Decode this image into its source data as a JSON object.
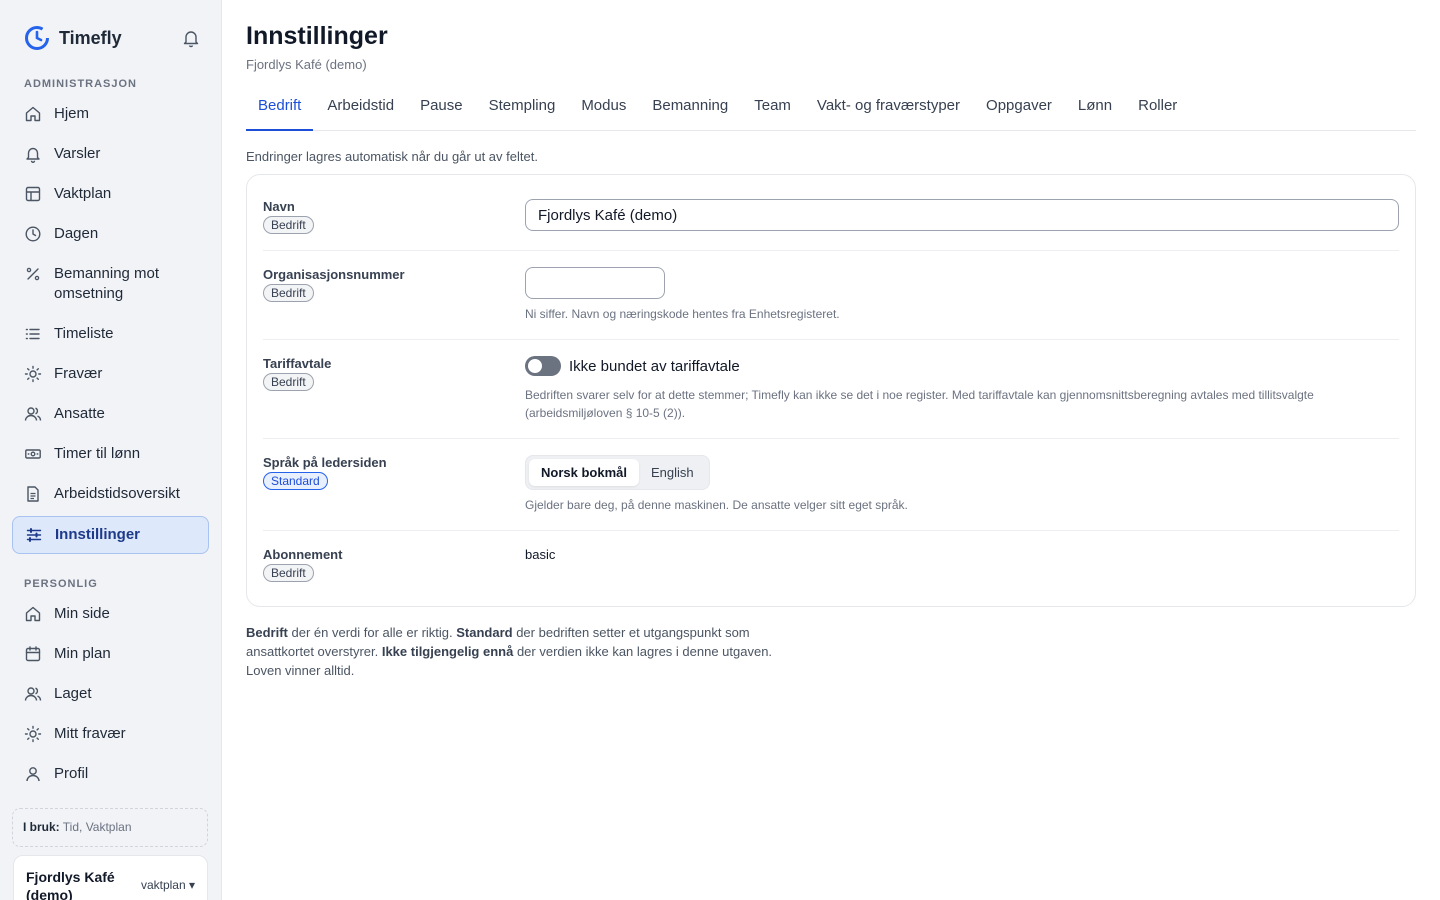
{
  "brand": {
    "name": "Timefly"
  },
  "sidebar": {
    "admin_label": "ADMINISTRASJON",
    "admin_items": [
      {
        "label": "Hjem",
        "icon": "home-icon"
      },
      {
        "label": "Varsler",
        "icon": "bell-icon"
      },
      {
        "label": "Vaktplan",
        "icon": "table-icon"
      },
      {
        "label": "Dagen",
        "icon": "clock-icon"
      },
      {
        "label": "Bemanning mot omsetning",
        "icon": "percent-icon"
      },
      {
        "label": "Timeliste",
        "icon": "list-icon"
      },
      {
        "label": "Fravær",
        "icon": "sun-icon"
      },
      {
        "label": "Ansatte",
        "icon": "users-icon"
      },
      {
        "label": "Timer til lønn",
        "icon": "money-icon"
      },
      {
        "label": "Arbeidstidsoversikt",
        "icon": "document-icon"
      },
      {
        "label": "Innstillinger",
        "icon": "sliders-icon",
        "active": true
      }
    ],
    "personal_label": "PERSONLIG",
    "personal_items": [
      {
        "label": "Min side",
        "icon": "home-icon"
      },
      {
        "label": "Min plan",
        "icon": "calendar-icon"
      },
      {
        "label": "Laget",
        "icon": "users-icon"
      },
      {
        "label": "Mitt fravær",
        "icon": "sun-icon"
      },
      {
        "label": "Profil",
        "icon": "user-icon"
      }
    ],
    "in_use_label": "I bruk:",
    "in_use_value": "Tid, Vaktplan",
    "org_name": "Fjordlys Kafé (demo)",
    "org_plan": "vaktplan ▾"
  },
  "main": {
    "title": "Innstillinger",
    "subtitle": "Fjordlys Kafé (demo)",
    "tabs": [
      "Bedrift",
      "Arbeidstid",
      "Pause",
      "Stempling",
      "Modus",
      "Bemanning",
      "Team",
      "Vakt- og fraværstyper",
      "Oppgaver",
      "Lønn",
      "Roller"
    ],
    "note": "Endringer lagres automatisk når du går ut av feltet.",
    "rows": {
      "navn": {
        "label": "Navn",
        "badge": "Bedrift",
        "value": "Fjordlys Kafé (demo)"
      },
      "orgnr": {
        "label": "Organisasjonsnummer",
        "badge": "Bedrift",
        "value": "",
        "help": "Ni siffer. Navn og næringskode hentes fra Enhetsregisteret."
      },
      "tariff": {
        "label": "Tariffavtale",
        "badge": "Bedrift",
        "toggle_label": "Ikke bundet av tariffavtale",
        "help": "Bedriften svarer selv for at dette stemmer; Timefly kan ikke se det i noe register. Med tariffavtale kan gjennomsnittsberegning avtales med tillitsvalgte (arbeidsmiljøloven § 10-5 (2))."
      },
      "sprak": {
        "label": "Språk på ledersiden",
        "badge": "Standard",
        "options": [
          "Norsk bokmål",
          "English"
        ],
        "help": "Gjelder bare deg, på denne maskinen. De ansatte velger sitt eget språk."
      },
      "abonnement": {
        "label": "Abonnement",
        "badge": "Bedrift",
        "value": "basic"
      }
    },
    "footer": {
      "b1": "Bedrift",
      "t1": " der én verdi for alle er riktig. ",
      "b2": "Standard",
      "t2": " der bedriften setter et utgangspunkt som ansattkortet overstyrer. ",
      "b3": "Ikke tilgjengelig ennå",
      "t3": " der verdien ikke kan lagres i denne utgaven. Loven vinner alltid."
    }
  }
}
